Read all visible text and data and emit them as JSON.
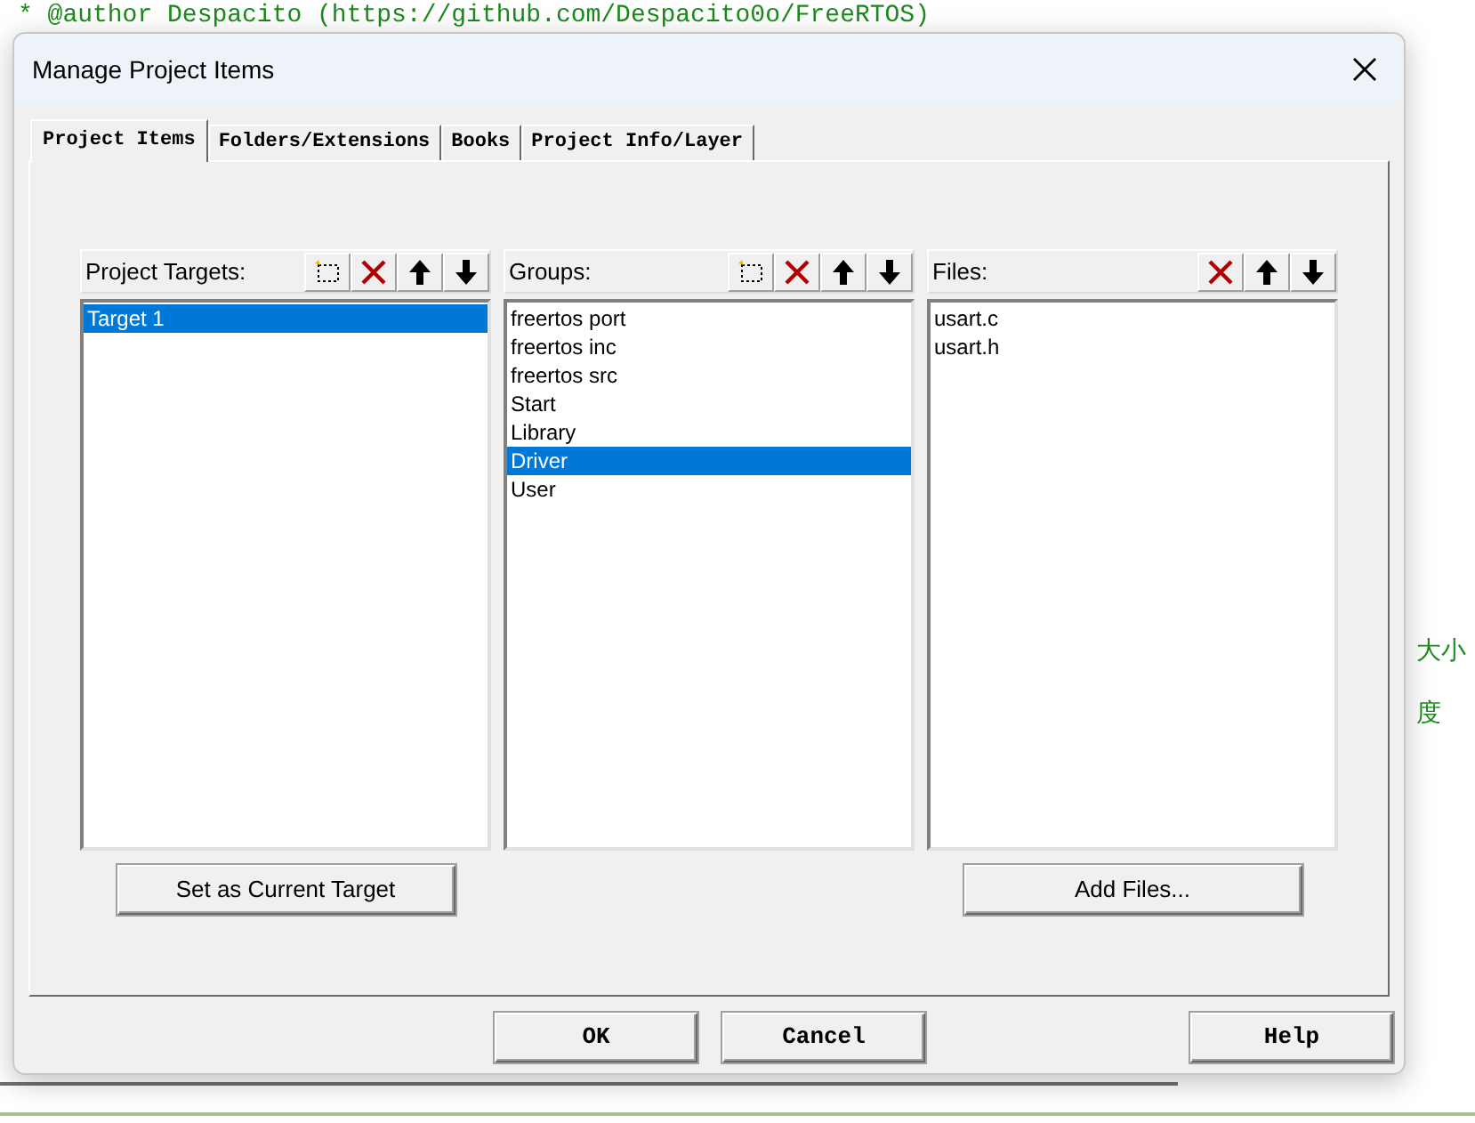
{
  "editor": {
    "lines": [
      "* @author Despacito (https://github.com/Despacito0o/FreeRTOS)"
    ],
    "side_texts": [
      "大小",
      "度"
    ]
  },
  "window": {
    "title": "Manage Project Items"
  },
  "tabs": [
    {
      "label": "Project Items",
      "selected": true
    },
    {
      "label": "Folders/Extensions",
      "selected": false
    },
    {
      "label": "Books",
      "selected": false
    },
    {
      "label": "Project Info/Layer",
      "selected": false
    }
  ],
  "panes": [
    {
      "title": "Project Targets:",
      "tools": [
        {
          "kind": "new"
        },
        {
          "kind": "delete"
        },
        {
          "kind": "up"
        },
        {
          "kind": "down"
        }
      ],
      "items": [
        {
          "label": "Target 1",
          "selected": true
        }
      ],
      "button": "Set as Current Target"
    },
    {
      "title": "Groups:",
      "tools": [
        {
          "kind": "new"
        },
        {
          "kind": "delete"
        },
        {
          "kind": "up"
        },
        {
          "kind": "down"
        }
      ],
      "items": [
        {
          "label": "freertos port",
          "selected": false
        },
        {
          "label": "freertos inc",
          "selected": false
        },
        {
          "label": "freertos src",
          "selected": false
        },
        {
          "label": "Start",
          "selected": false
        },
        {
          "label": "Library",
          "selected": false
        },
        {
          "label": "Driver",
          "selected": true
        },
        {
          "label": "User",
          "selected": false
        }
      ]
    },
    {
      "title": "Files:",
      "tools": [
        {
          "kind": "delete"
        },
        {
          "kind": "up"
        },
        {
          "kind": "down"
        }
      ],
      "items": [
        {
          "label": "usart.c",
          "selected": false
        },
        {
          "label": "usart.h",
          "selected": false
        }
      ],
      "button": "Add Files..."
    }
  ],
  "buttons": {
    "ok": "OK",
    "cancel": "Cancel",
    "help": "Help"
  }
}
